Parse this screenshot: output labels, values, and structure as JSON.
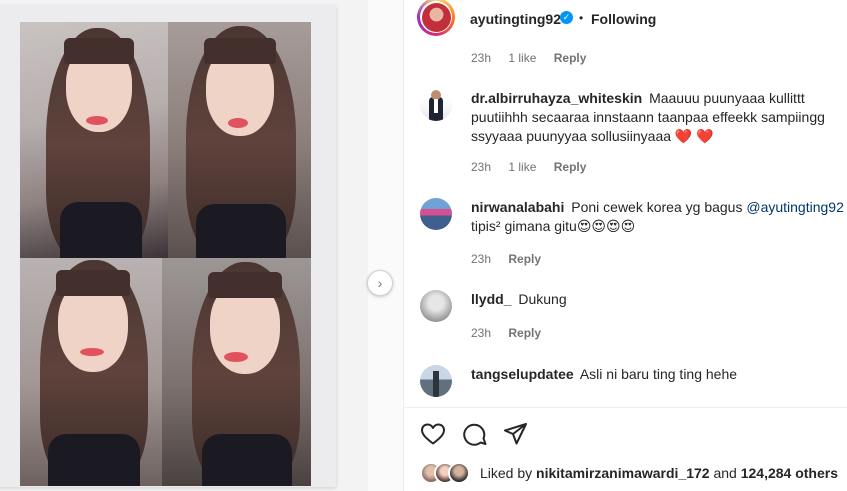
{
  "post": {
    "owner": "ayutingting92",
    "verified_mark": "✓",
    "separator": "•",
    "follow_status": "Following"
  },
  "top_meta": {
    "time": "23h",
    "likes": "1 like",
    "reply": "Reply"
  },
  "comments": [
    {
      "user": "dr.albirruhayza_whiteskin",
      "text": "Maauuu puunyaaa kullittt puutiihhh secaaraa innstaann taanpaa effeekk sampiingg ssyyaaa puunyyaa sollusiinyaaa",
      "hearts": "❤️ ❤️",
      "time": "23h",
      "likes": "1 like",
      "reply": "Reply"
    },
    {
      "user": "nirwanalabahi",
      "text_before": "Poni cewek korea yg bagus",
      "mention": "@ayutingting92",
      "text_after": "tipis² gimana gitu😍😍😍😍",
      "time": "23h",
      "reply": "Reply"
    },
    {
      "user": "llydd_",
      "text": "Dukung",
      "time": "23h",
      "reply": "Reply"
    },
    {
      "user": "tangselupdatee",
      "text": "Asli ni baru ting ting hehe"
    }
  ],
  "likes": {
    "prefix": "Liked by",
    "user": "nikitamirzanimawardi_172",
    "joiner": "and",
    "others": "124,284 others"
  },
  "icons": {
    "next": "chevron-right-icon",
    "like": "heart-icon",
    "comment": "comment-bubble-icon",
    "share": "paper-plane-icon",
    "verified": "verified-badge-icon"
  },
  "colors": {
    "verified": "#0095f6",
    "link": "#00376b",
    "muted": "#737373",
    "heart": "#e0242f"
  }
}
